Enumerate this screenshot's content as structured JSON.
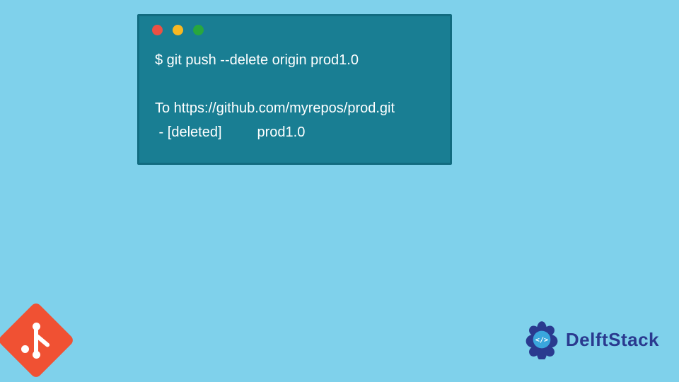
{
  "terminal": {
    "lines": [
      "$ git push --delete origin prod1.0",
      "",
      "To https://github.com/myrepos/prod.git",
      " - [deleted]         prod1.0"
    ]
  },
  "branding": {
    "site_name": "DelftStack"
  },
  "icons": {
    "git": "git-icon",
    "brand": "delftstack-logo"
  },
  "colors": {
    "page_bg": "#7fd1eb",
    "terminal_bg": "#197e93",
    "terminal_border": "#116b80",
    "git_orange": "#f05133",
    "brand_blue": "#2a3a8f"
  }
}
